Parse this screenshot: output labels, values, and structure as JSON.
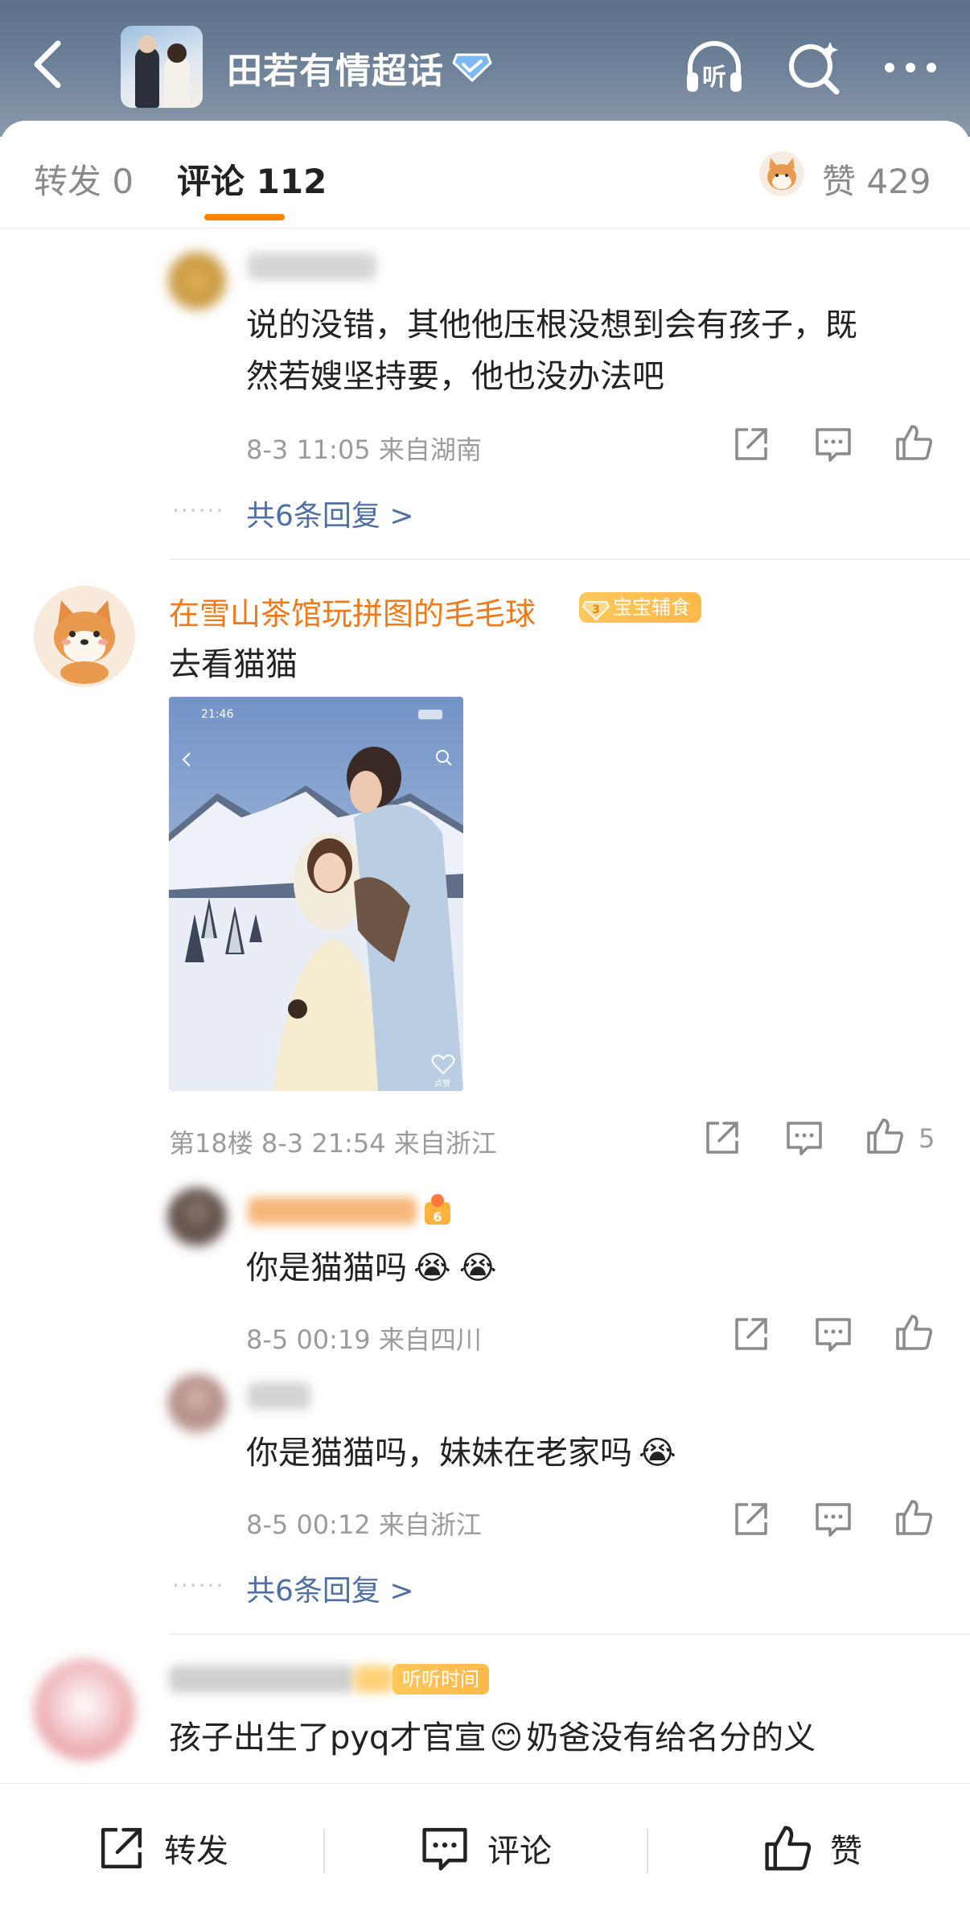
{
  "header": {
    "title": "田若有情超话",
    "listen_label": "听"
  },
  "tabs": {
    "repost": "转发 0",
    "comment": "评论 112",
    "like": "赞 429"
  },
  "comments": [
    {
      "id": "reply-a",
      "text_line1": "说的没错，其他他压根没想到会有孩子，既",
      "text_line2": "然若嫂坚持要，他也没办法吧",
      "meta": "8-3 11:05  来自湖南",
      "more_replies": "共6条回复 >"
    },
    {
      "id": "floor-18",
      "username": "在雪山茶馆玩拼图的毛毛球",
      "badge_level": "3",
      "badge": "宝宝辅食",
      "text": "去看猫猫",
      "photo": {
        "status_time": "21:46",
        "like_label": "点赞"
      },
      "meta": "第18楼  8-3 21:54  来自浙江",
      "likes": "5",
      "replies": [
        {
          "text": "你是猫猫吗",
          "emoji": [
            "😭",
            "😭"
          ],
          "meta": "8-5 00:19  来自四川"
        },
        {
          "text": "你是猫猫吗，妹妹在老家吗",
          "emoji": [
            "😭"
          ],
          "meta": "8-5 00:12  来自浙江"
        }
      ],
      "more_replies": "共6条回复 >"
    },
    {
      "id": "next",
      "badge": "听听时间",
      "text_before": "孩子出生了pyq才官宣",
      "emoji": "😊",
      "text_after": "奶爸没有给名分的义"
    }
  ],
  "bottom_bar": {
    "repost": "转发",
    "comment": "评论",
    "like": "赞"
  },
  "colors": {
    "accent": "#ff8200",
    "username": "#ef7a1a",
    "link": "#506fa5",
    "meta": "#9b9b9b"
  }
}
